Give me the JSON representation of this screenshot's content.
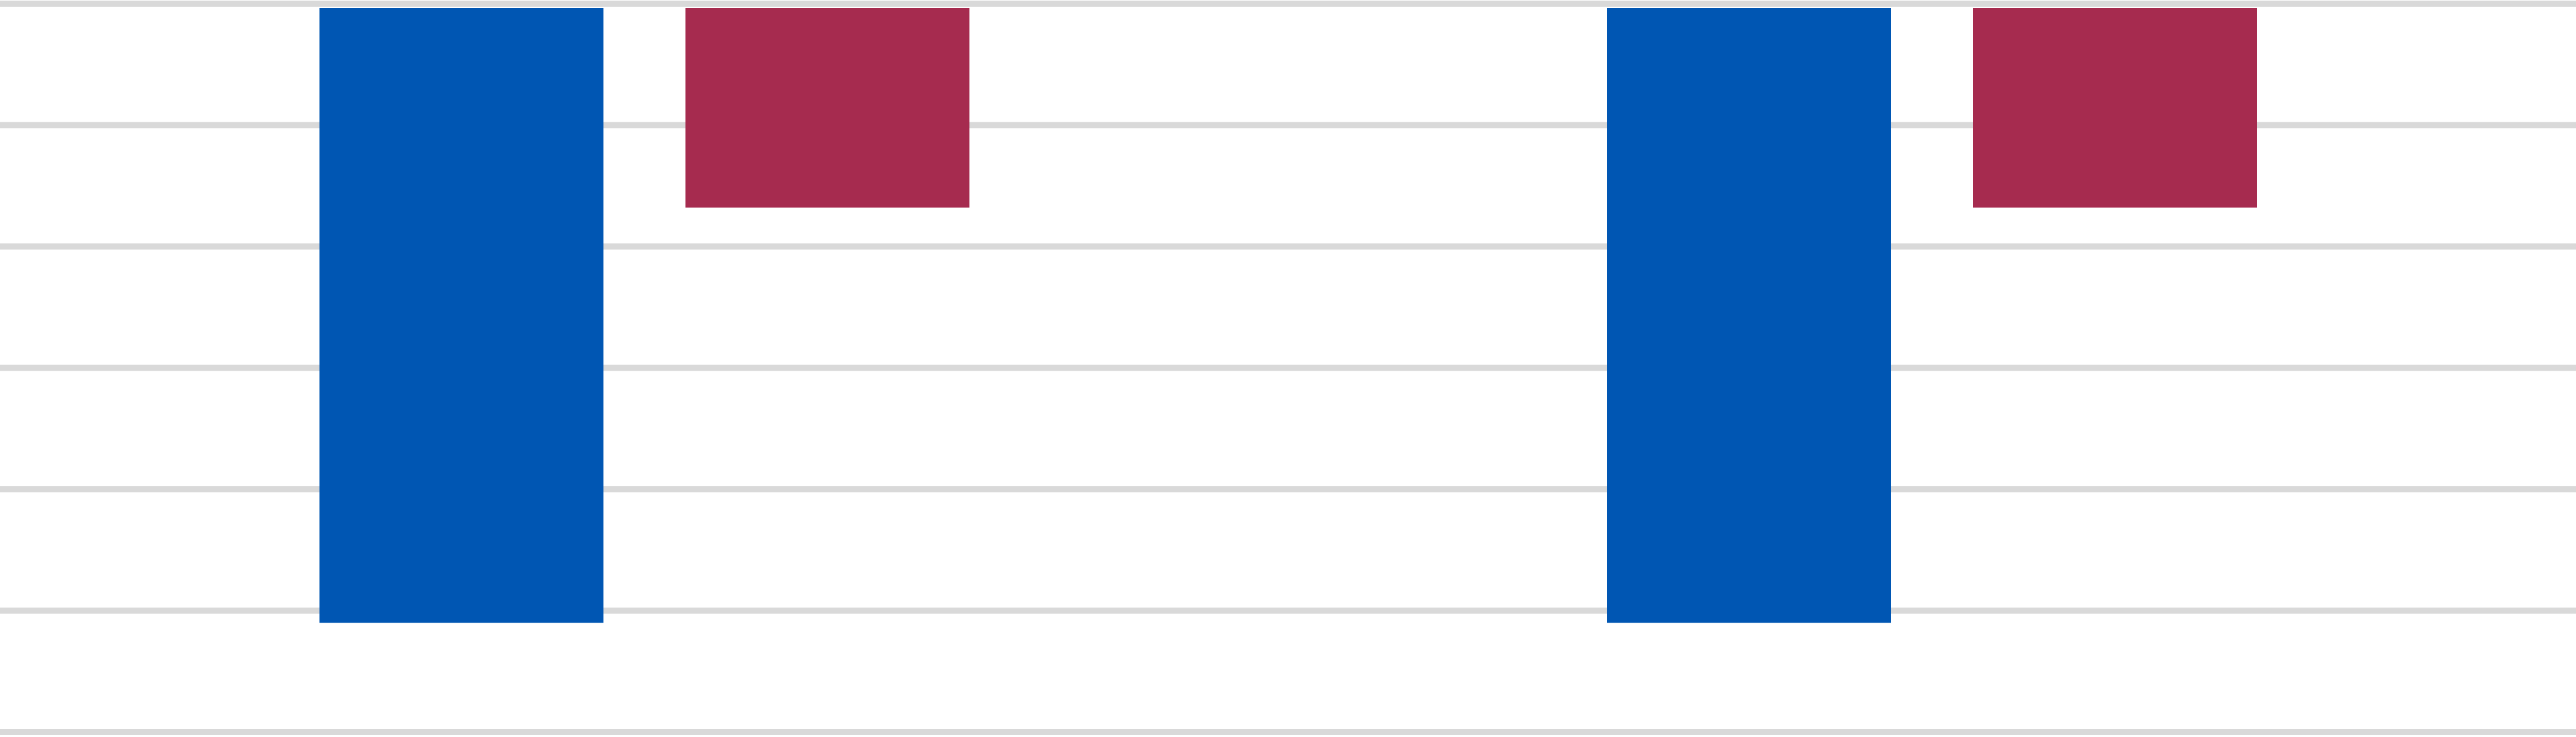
{
  "chart_data": {
    "type": "bar",
    "orientation": "vertical",
    "bars_hang_from": "top",
    "grid": true,
    "legend": "none",
    "title": "",
    "xlabel": "",
    "ylabel": "",
    "ylim": [
      0,
      6
    ],
    "categories": [
      "",
      ""
    ],
    "series": [
      {
        "color": "#0056b3",
        "values": [
          5.1,
          5.1
        ]
      },
      {
        "color": "#a62b4f",
        "values": [
          1.68,
          1.68
        ]
      }
    ],
    "colors": {
      "grid": "#d9d9d9",
      "background": "#ffffff"
    }
  }
}
